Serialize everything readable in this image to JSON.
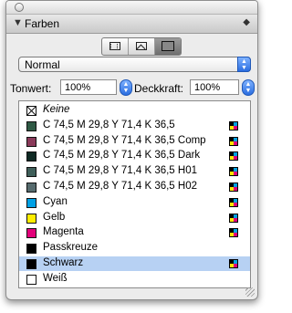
{
  "panel": {
    "title": "Farben"
  },
  "mode_select": {
    "value": "Normal"
  },
  "tonwert": {
    "label": "Tonwert:",
    "value": "100%"
  },
  "deckkraft": {
    "label": "Deckkraft:",
    "value": "100%"
  },
  "colors": [
    {
      "name": "Keine",
      "swatch": "none",
      "italic": true,
      "cmyk": false,
      "selected": false
    },
    {
      "name": "C 74,5 M 29,8 Y 71,4 K 36,5",
      "swatch": "#2f5a45",
      "italic": false,
      "cmyk": true,
      "selected": false
    },
    {
      "name": "C 74,5 M 29,8 Y 71,4 K 36,5 Comp",
      "swatch": "#8a3a5a",
      "italic": false,
      "cmyk": true,
      "selected": false
    },
    {
      "name": "C 74,5 M 29,8 Y 71,4 K 36,5 Dark",
      "swatch": "#0f2a24",
      "italic": false,
      "cmyk": true,
      "selected": false
    },
    {
      "name": "C 74,5 M 29,8 Y 71,4 K 36,5 H01",
      "swatch": "#3f5f5a",
      "italic": false,
      "cmyk": true,
      "selected": false
    },
    {
      "name": "C 74,5 M 29,8 Y 71,4 K 36,5 H02",
      "swatch": "#566b6e",
      "italic": false,
      "cmyk": true,
      "selected": false
    },
    {
      "name": "Cyan",
      "swatch": "#00a0e4",
      "italic": false,
      "cmyk": true,
      "selected": false
    },
    {
      "name": "Gelb",
      "swatch": "#ffed00",
      "italic": false,
      "cmyk": true,
      "selected": false
    },
    {
      "name": "Magenta",
      "swatch": "#e2007a",
      "italic": false,
      "cmyk": true,
      "selected": false
    },
    {
      "name": "Passkreuze",
      "swatch": "#000000",
      "italic": false,
      "cmyk": false,
      "selected": false
    },
    {
      "name": "Schwarz",
      "swatch": "#000000",
      "italic": false,
      "cmyk": true,
      "selected": true
    },
    {
      "name": "Weiß",
      "swatch": "#ffffff",
      "italic": false,
      "cmyk": false,
      "selected": false
    }
  ]
}
